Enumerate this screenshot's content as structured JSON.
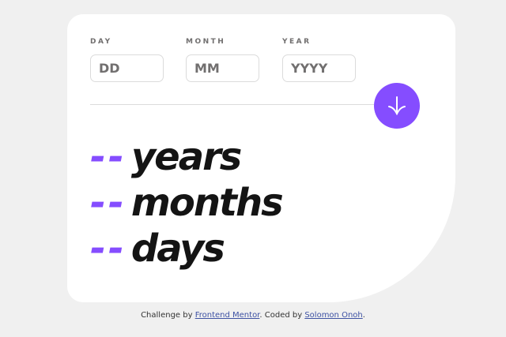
{
  "form": {
    "day": {
      "label": "DAY",
      "placeholder": "DD",
      "value": ""
    },
    "month": {
      "label": "MONTH",
      "placeholder": "MM",
      "value": ""
    },
    "year": {
      "label": "YEAR",
      "placeholder": "YYYY",
      "value": ""
    },
    "submit_icon": "arrow-down-icon"
  },
  "results": {
    "years": {
      "value": "--",
      "unit": "years"
    },
    "months": {
      "value": "--",
      "unit": "months"
    },
    "days": {
      "value": "--",
      "unit": "days"
    }
  },
  "attribution": {
    "prefix": "Challenge by",
    "challenge_link": "Frontend Mentor",
    "middle": ". Coded by",
    "author_link": "Solomon Onoh",
    "suffix": "."
  },
  "colors": {
    "accent": "#854dff",
    "background": "#f0f0f0",
    "card": "#ffffff",
    "text": "#141414",
    "label": "#716f6f"
  }
}
